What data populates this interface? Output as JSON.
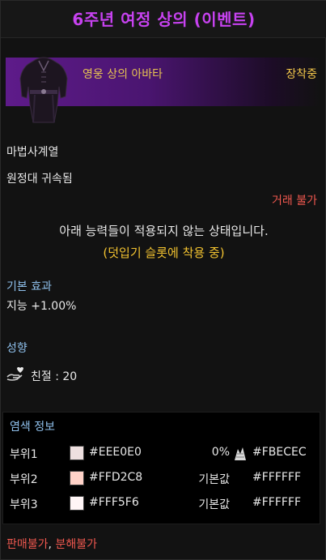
{
  "title": "6주년 여정 상의 (이벤트)",
  "item": {
    "name": "영웅 상의 아바타",
    "equip_status": "장착중",
    "icon": "robe-icon"
  },
  "job": "마법사계열",
  "bind": "원정대 귀속됨",
  "trade": "거래 불가",
  "warning": {
    "line1": "아래 능력들이 적용되지 않는 상태입니다.",
    "line2": "(덧입기 슬롯에 착용 중)"
  },
  "basic_effect": {
    "label": "기본 효과",
    "value": "지능 +1.00%"
  },
  "tendency": {
    "label": "성향",
    "icon": "hand-heart-icon",
    "value": "친절 : 20"
  },
  "dye": {
    "label": "염색 정보",
    "rows": [
      {
        "part": "부위1",
        "swatch": "#EEE0E0",
        "hex": "#EEE0E0",
        "val": "0%",
        "swatch2": "pattern",
        "hex2": "#FBECEC"
      },
      {
        "part": "부위2",
        "swatch": "#FFD2C8",
        "hex": "#FFD2C8",
        "val": "기본값",
        "swatch2": "#000000",
        "hex2": "#FFFFFF"
      },
      {
        "part": "부위3",
        "swatch": "#FFF5F6",
        "hex": "#FFF5F6",
        "val": "기본값",
        "swatch2": "#000000",
        "hex2": "#FFFFFF"
      }
    ]
  },
  "footer": {
    "sell": "판매불가",
    "sep": ", ",
    "dismantle": "분해불가"
  }
}
